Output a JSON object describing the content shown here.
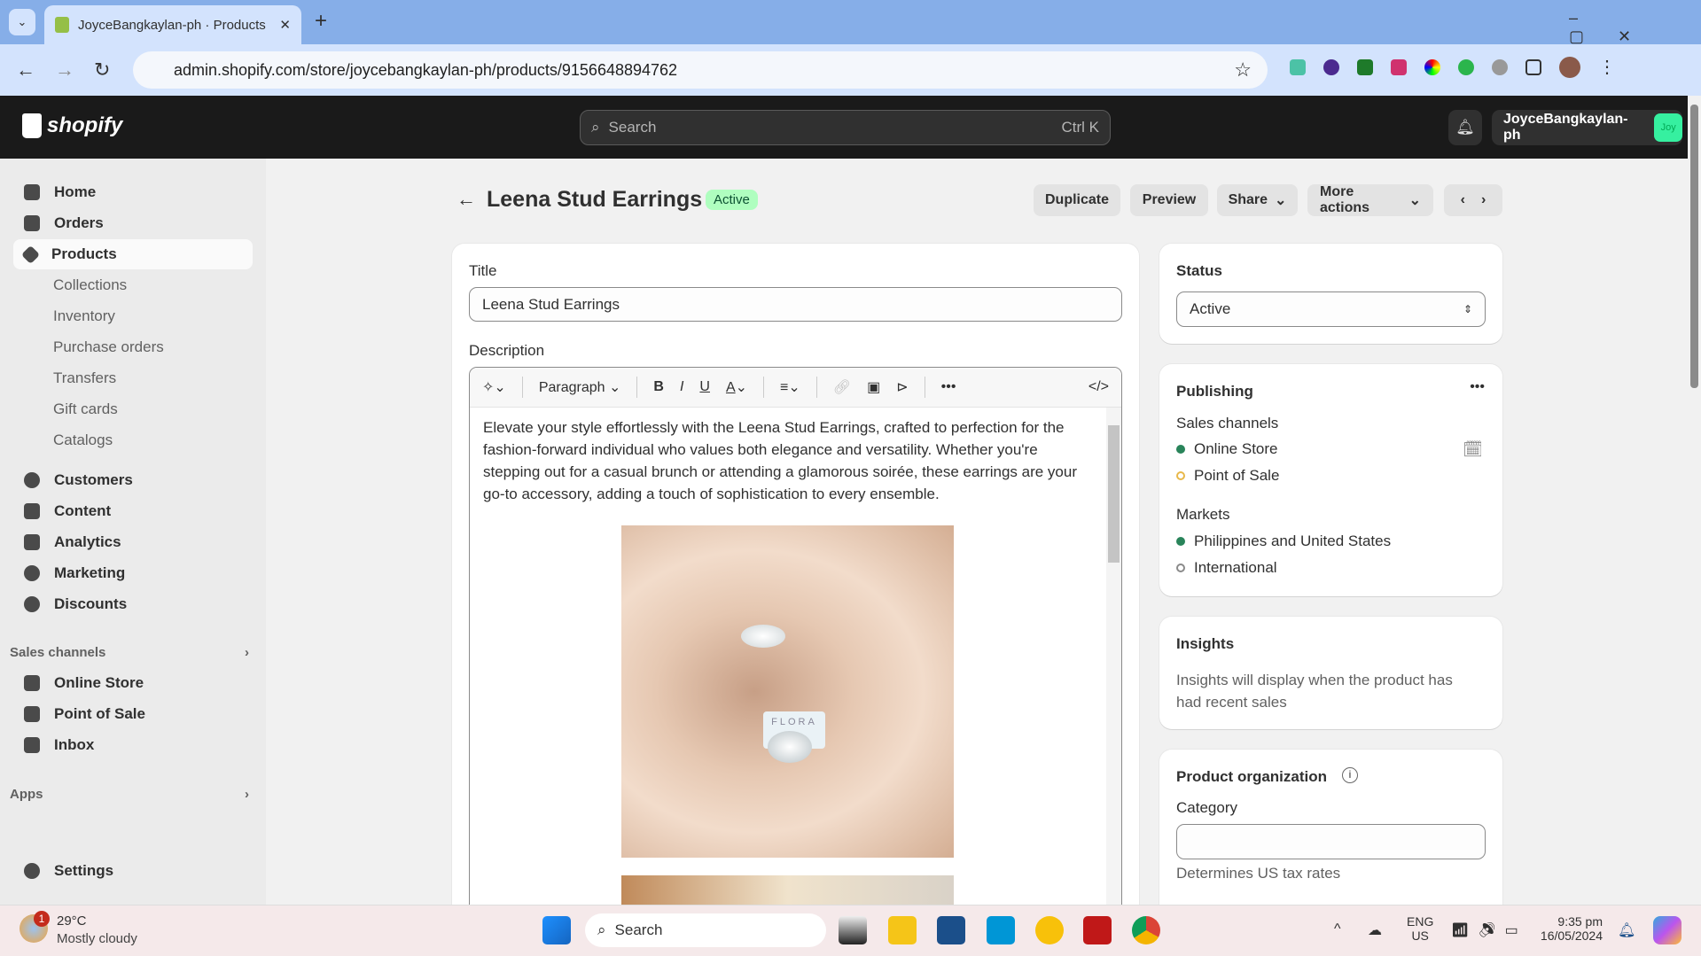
{
  "browser": {
    "tab_title": "JoyceBangkaylan-ph · Products",
    "url": "admin.shopify.com/store/joycebangkaylan-ph/products/9156648894762"
  },
  "header": {
    "logo": "shopify",
    "search_placeholder": "Search",
    "search_shortcut": "Ctrl K",
    "store_name": "JoyceBangkaylan-ph",
    "avatar": "Joy"
  },
  "sidebar": {
    "items": [
      {
        "label": "Home"
      },
      {
        "label": "Orders"
      },
      {
        "label": "Products"
      },
      {
        "label": "Collections"
      },
      {
        "label": "Inventory"
      },
      {
        "label": "Purchase orders"
      },
      {
        "label": "Transfers"
      },
      {
        "label": "Gift cards"
      },
      {
        "label": "Catalogs"
      },
      {
        "label": "Customers"
      },
      {
        "label": "Content"
      },
      {
        "label": "Analytics"
      },
      {
        "label": "Marketing"
      },
      {
        "label": "Discounts"
      }
    ],
    "sales_channels_label": "Sales channels",
    "channels": [
      {
        "label": "Online Store"
      },
      {
        "label": "Point of Sale"
      },
      {
        "label": "Inbox"
      }
    ],
    "apps_label": "Apps",
    "settings": "Settings"
  },
  "page": {
    "title": "Leena Stud Earrings",
    "status_badge": "Active",
    "actions": {
      "duplicate": "Duplicate",
      "preview": "Preview",
      "share": "Share",
      "more": "More actions"
    }
  },
  "main": {
    "title_label": "Title",
    "title_value": "Leena Stud Earrings",
    "description_label": "Description",
    "paragraph": "Paragraph",
    "description_text": "Elevate your style effortlessly with the Leena Stud Earrings, crafted to perfection for the fashion-forward individual who values both elegance and versatility. Whether you're stepping out for a casual brunch or attending a glamorous soirée, these earrings are your go-to accessory, adding a touch of sophistication to every ensemble.",
    "image_card_text": "FLORA"
  },
  "status": {
    "label": "Status",
    "value": "Active"
  },
  "publishing": {
    "title": "Publishing",
    "sales_channels_label": "Sales channels",
    "channels": [
      {
        "label": "Online Store",
        "color": "#29845a"
      },
      {
        "label": "Point of Sale",
        "color": "#e8b84a"
      }
    ],
    "markets_label": "Markets",
    "markets": [
      {
        "label": "Philippines and United States",
        "color": "#29845a"
      },
      {
        "label": "International",
        "color": "#8a8a8a"
      }
    ]
  },
  "insights": {
    "title": "Insights",
    "text": "Insights will display when the product has had recent sales"
  },
  "organization": {
    "title": "Product organization",
    "category_label": "Category",
    "category_value": "",
    "category_help": "Determines US tax rates"
  },
  "taskbar": {
    "temp": "29°C",
    "weather": "Mostly cloudy",
    "weather_badge": "1",
    "search": "Search",
    "lang1": "ENG",
    "lang2": "US",
    "time": "9:35 pm",
    "date": "16/05/2024"
  }
}
